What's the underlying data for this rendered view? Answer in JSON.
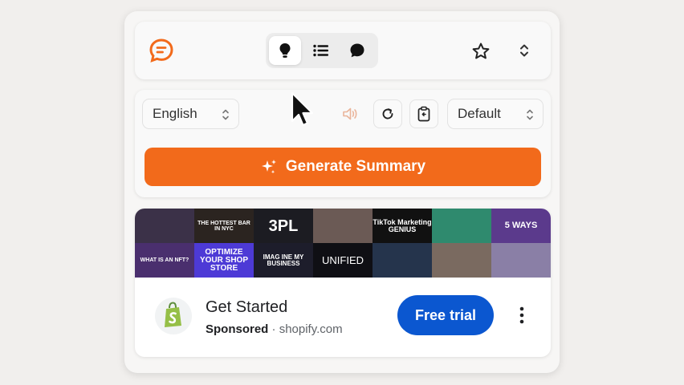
{
  "toolbar": {
    "tabs": [
      {
        "icon": "lightbulb-icon",
        "active": true
      },
      {
        "icon": "list-icon",
        "active": false
      },
      {
        "icon": "chat-bubble-icon",
        "active": false
      }
    ],
    "star_icon": "star-icon",
    "expand_icon": "chevron-updown-icon"
  },
  "controls": {
    "language_select": "English",
    "style_select": "Default",
    "speaker_icon": "speaker-icon",
    "refresh_icon": "refresh-icon",
    "clipboard_icon": "clipboard-icon",
    "generate_label": "Generate Summary",
    "accent_color": "#f26a1b"
  },
  "ad": {
    "collage_labels": [
      "THE HOTTEST BAR IN NYC",
      "3PL",
      "TikTok Marketing GENIUS",
      "5 WAYS",
      "WHAT IS AN NFT?",
      "OPTIMIZE YOUR SHOP STORE",
      "IMAG INE MY BUSINESS",
      "UNIFIED"
    ],
    "title": "Get Started",
    "sponsored": "Sponsored",
    "separator": "·",
    "domain": "shopify.com",
    "cta": "Free trial",
    "cta_color": "#0b57d0"
  }
}
